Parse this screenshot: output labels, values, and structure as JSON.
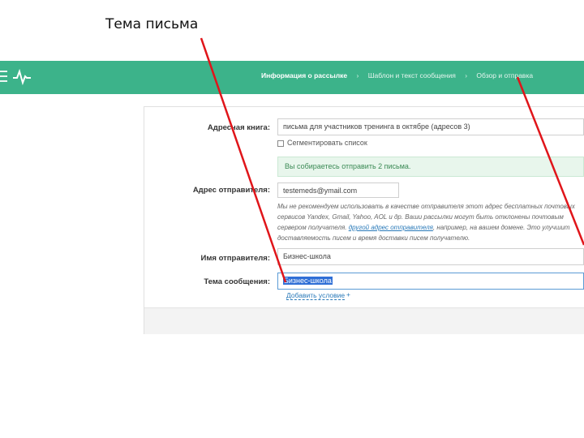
{
  "slide_title": "Тема письма",
  "header": {
    "steps": [
      "Информация о рассылке",
      "Шаблон и текст сообщения",
      "Обзор и отправка"
    ],
    "active_step": 0,
    "separator": "›"
  },
  "form": {
    "address_book_label": "Адресная книга:",
    "address_book_value": "письма для участников тренинга в октябре (адресов 3)",
    "segment_label": "Сегментировать список",
    "notice": "Вы собираетесь отправить 2 письма.",
    "sender_address_label": "Адрес отправителя:",
    "sender_address_value": "testemeds@ymail.com",
    "warning_text": "Мы не рекомендуем использовать в качестве отправителя этот адрес бесплатных почтовых сервисов Yandex, Gmail, Yahoo, AOL и др. Ваши рассылки могут быть отклонены почтовым сервером получателя.",
    "warning_link": "другой адрес отправителя",
    "warning_prefix": "",
    "warning_suffix": ", например, на вашем домене. Это улучшит доставляемость писем и время доставки писем получателю.",
    "sender_name_label": "Имя отправителя:",
    "sender_name_value": "Бизнес-школа",
    "subject_label": "Тема сообщения:",
    "subject_value": "Бизнес-школа",
    "add_condition": "Добавить условие",
    "add_condition_plus": "+"
  },
  "colors": {
    "header_bg": "#3cb38a",
    "arrow": "#e0151a",
    "link": "#2a7ab9",
    "selection": "#2f6fd6"
  }
}
